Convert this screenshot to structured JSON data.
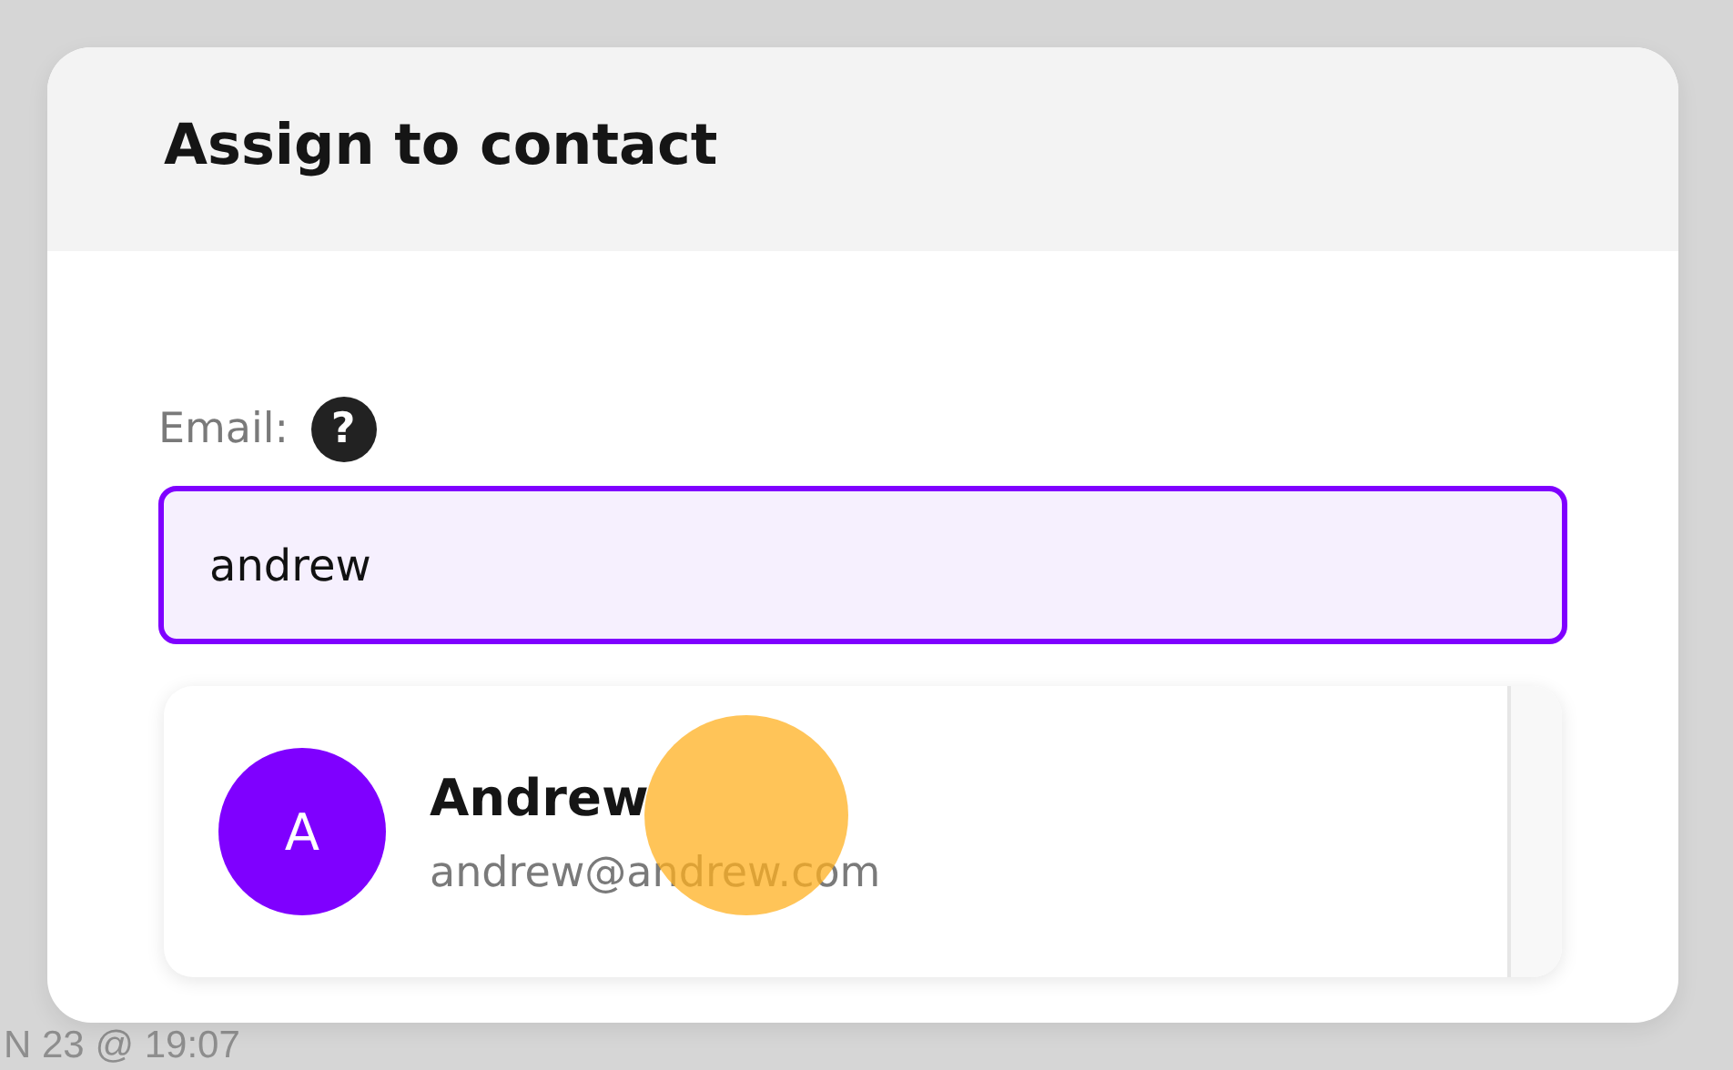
{
  "background": {
    "text": "N 23 @ 19:07"
  },
  "dialog": {
    "title": "Assign to contact"
  },
  "email_field": {
    "label": "Email:",
    "help_icon": "?",
    "value": "andrew",
    "focused": true
  },
  "suggestions": [
    {
      "initial": "A",
      "name": "Andrew",
      "email": "andrew@andrew.com",
      "color": "#7f00ff"
    }
  ],
  "click_indicator": true
}
